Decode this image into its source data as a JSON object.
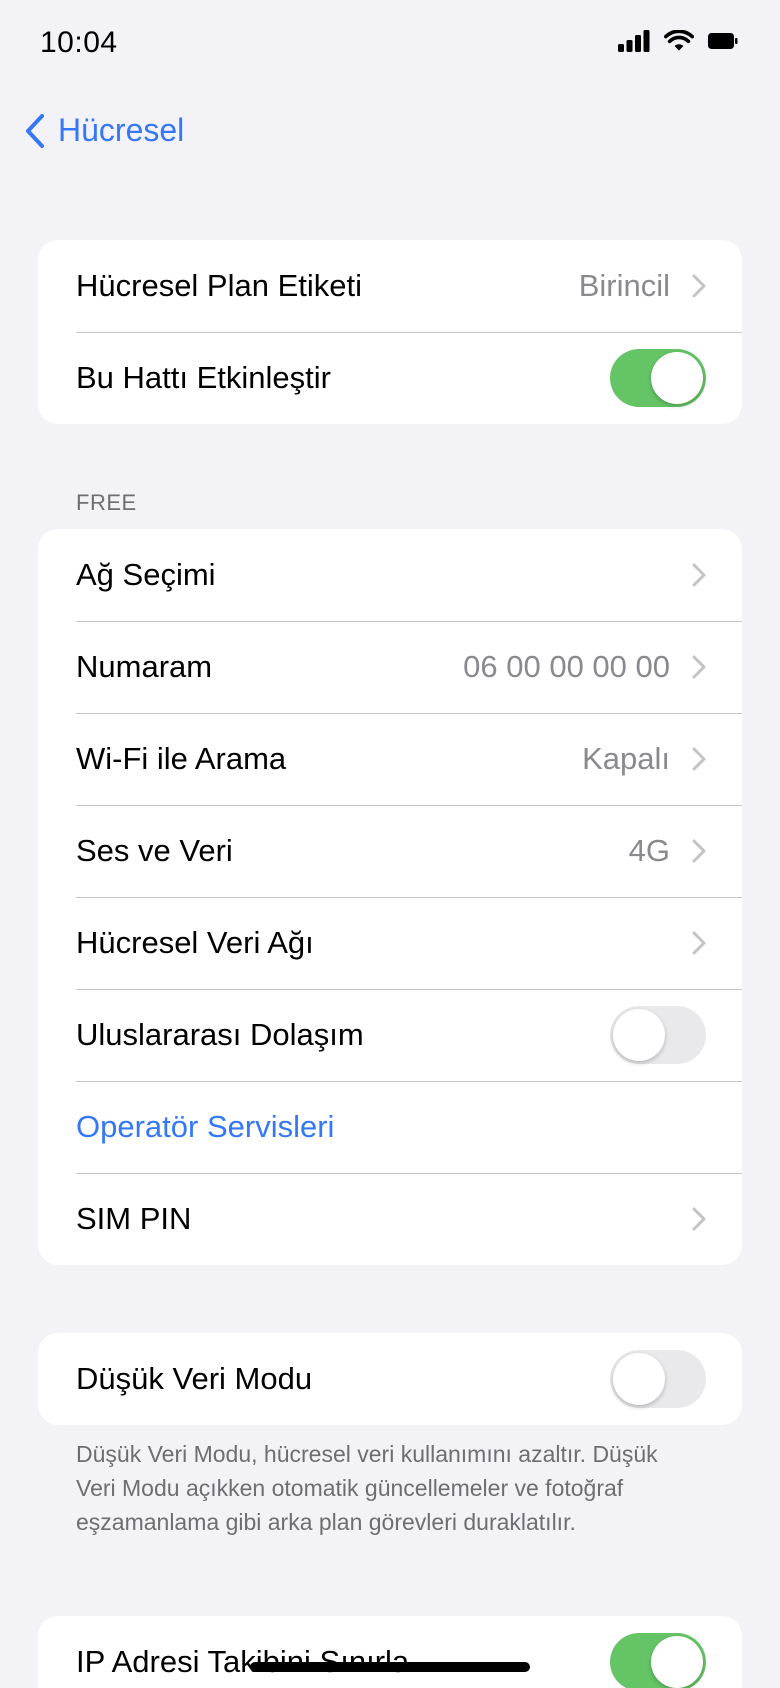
{
  "status_bar": {
    "time": "10:04"
  },
  "nav": {
    "back_label": "Hücresel"
  },
  "group_plan": {
    "rows": [
      {
        "label": "Hücresel Plan Etiketi",
        "value": "Birincil"
      },
      {
        "label": "Bu Hattı Etkinleştir",
        "toggle": true
      }
    ]
  },
  "section_free": {
    "header": "FREE"
  },
  "group_free": {
    "rows": [
      {
        "label": "Ağ Seçimi"
      },
      {
        "label": "Numaram",
        "value": "06 00 00 00 00"
      },
      {
        "label": "Wi-Fi ile Arama",
        "value": "Kapalı"
      },
      {
        "label": "Ses ve Veri",
        "value": "4G"
      },
      {
        "label": "Hücresel Veri Ağı"
      },
      {
        "label": "Uluslararası Dolaşım",
        "toggle": false
      },
      {
        "label": "Operatör Servisleri"
      },
      {
        "label": "SIM PIN"
      }
    ]
  },
  "group_low_data": {
    "row": {
      "label": "Düşük Veri Modu",
      "toggle": false
    },
    "footer": "Düşük Veri Modu, hücresel veri kullanımını azaltır. Düşük Veri Modu açıkken otomatik güncellemeler ve fotoğraf eşzamanlama gibi arka plan görevleri duraklatılır."
  },
  "group_ip": {
    "row": {
      "label": "IP Adresi Takibini Sınırla",
      "toggle": true
    }
  },
  "colors": {
    "accent": "#3478f6",
    "toggle_on": "#65c466",
    "toggle_off": "#e9e9eb",
    "background": "#f2f2f7"
  }
}
